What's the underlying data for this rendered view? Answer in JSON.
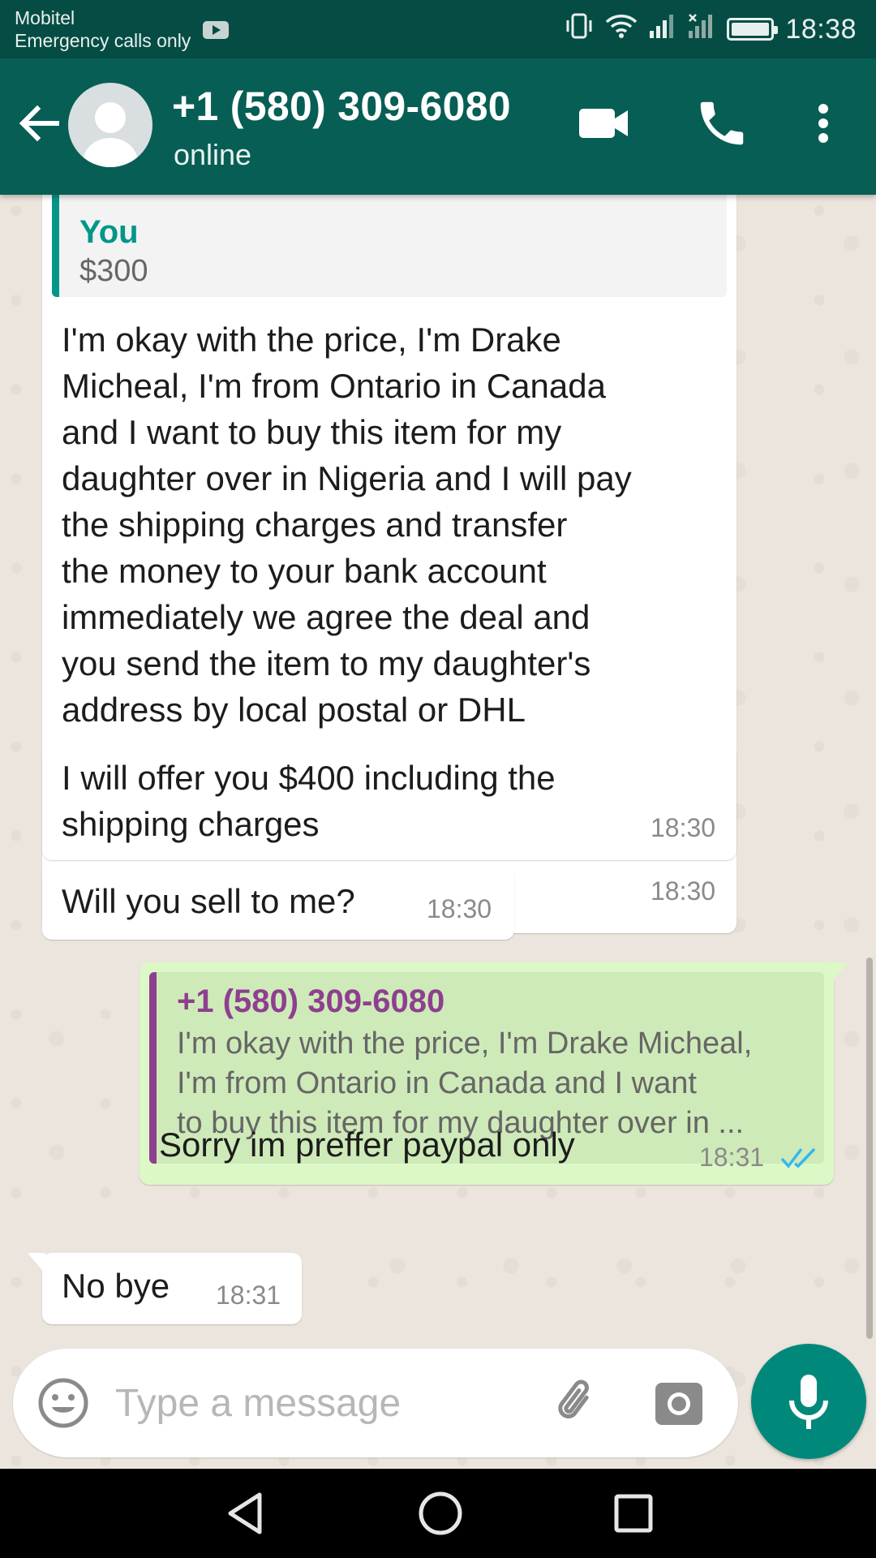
{
  "status_bar": {
    "carrier": "Mobitel",
    "emergency": "Emergency calls only",
    "time": "18:38",
    "icons": [
      "youtube-notification-icon",
      "vibrate-icon",
      "wifi-icon",
      "signal-icon",
      "no-signal-icon",
      "battery-icon"
    ]
  },
  "header": {
    "contact_name": "+1 (580) 309-6080",
    "contact_status": "online",
    "icons": [
      "back-arrow-icon",
      "avatar-icon",
      "video-call-icon",
      "voice-call-icon",
      "more-options-icon"
    ]
  },
  "messages": [
    {
      "direction": "in",
      "quote": {
        "sender": "You",
        "text": "$300"
      },
      "lines": [
        "I'm okay with the price, I'm Drake",
        "Micheal, I'm from Ontario in Canada",
        "and I want to buy this item for my",
        "daughter over in Nigeria and I will pay",
        "the shipping charges and transfer",
        "the money to your bank account",
        "immediately we agree the deal and",
        "you send the item to my daughter's",
        "address by local postal or DHL"
      ],
      "time": "18:30"
    },
    {
      "direction": "in",
      "lines": [
        "I will offer you $400 including the",
        "shipping charges"
      ],
      "time": "18:30"
    },
    {
      "direction": "in",
      "lines": [
        "Will you sell to me?"
      ],
      "time": "18:30"
    },
    {
      "direction": "out",
      "quote": {
        "sender": "+1 (580) 309-6080",
        "lines": [
          "I'm okay with the price, I'm Drake Micheal,",
          "I'm from Ontario in Canada and I want",
          "to buy this item for my daughter over in ..."
        ]
      },
      "lines": [
        "Sorry im preffer paypal only"
      ],
      "time": "18:31",
      "status": "read"
    },
    {
      "direction": "in",
      "lines": [
        "No bye"
      ],
      "time": "18:31"
    }
  ],
  "composer": {
    "placeholder": "Type a message",
    "icons": [
      "emoji-icon",
      "attach-icon",
      "camera-icon",
      "microphone-icon"
    ]
  },
  "colors": {
    "status_bar": "#054d44",
    "app_bar": "#075e54",
    "chat_bg": "#ece5dd",
    "incoming": "#ffffff",
    "outgoing": "#dcf8c6",
    "quote_own_accent": "#009688",
    "quote_contact_accent": "#8e3f8f",
    "read_ticks": "#34b7f1",
    "mic_button": "#00897b"
  }
}
